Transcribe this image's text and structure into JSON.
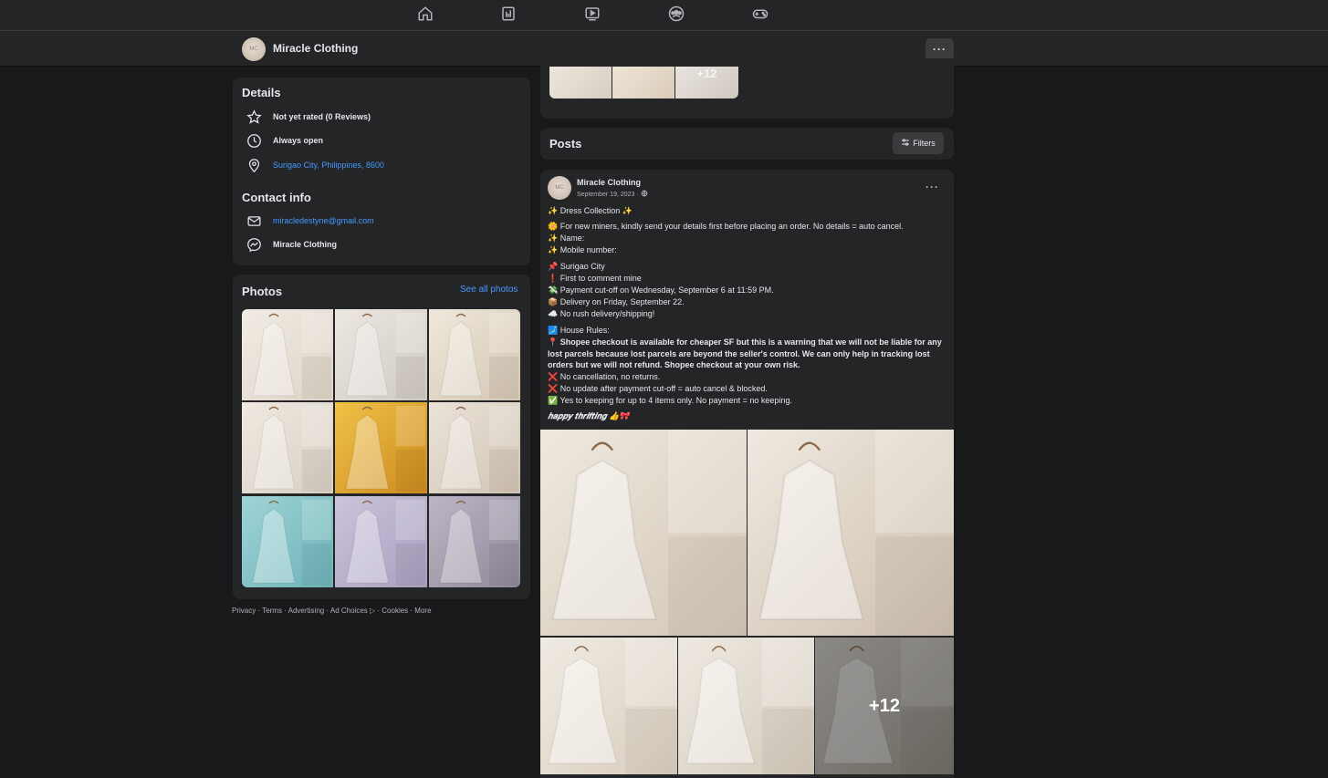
{
  "nav": {
    "icons": [
      "home-icon",
      "pages-icon",
      "video-icon",
      "groups-icon",
      "gaming-icon"
    ]
  },
  "pagebar": {
    "name": "Miracle Clothing",
    "more_label": "···"
  },
  "details": {
    "title": "Details",
    "rating": "Not yet rated (0 Reviews)",
    "hours": "Always open",
    "location": "Surigao City, Philippines, 8600"
  },
  "contact": {
    "title": "Contact info",
    "email": "miracledestyne@gmail.com",
    "messenger": "Miracle Clothing"
  },
  "photos": {
    "title": "Photos",
    "see_all": "See all photos"
  },
  "footer": {
    "text": "Privacy · Terms · Advertising · Ad Choices ▷ · Cookies · More"
  },
  "top_card": {
    "more_count": "+12"
  },
  "posts_header": {
    "title": "Posts",
    "filters_label": "Filters"
  },
  "post": {
    "author": "Miracle Clothing",
    "date": "September 19, 2023 ·",
    "more_label": "···",
    "lines": [
      "✨ Dress Collection ✨",
      "🌼 For new miners, kindly send your details first before placing an order. No details = auto cancel.",
      "✨ Name:",
      "✨ Mobile number:",
      "📌 Surigao City",
      "❗ First to comment mine",
      "💸 Payment cut-off on Wednesday, September 6 at 11:59 PM.",
      "📦 Delivery on Friday, September 22.",
      "☁️ No rush delivery/shipping!",
      "🗾 House Rules:",
      "📍 Shopee checkout is available for cheaper SF but this is a warning that we will not be liable for any",
      "lost parcels because lost parcels are beyond the seller's control. We can only help in tracking lost",
      "orders but we will not refund. Shopee checkout at your own risk.",
      "❌ No cancellation, no returns.",
      "❌ No update after payment cut-off = auto cancel & blocked.",
      "✅ Yes to keeping for up to 4 items only. No payment = no keeping.",
      "𝒉𝒂𝒑𝒑𝒚 𝒕𝒉𝒓𝒊𝒇𝒕𝒊𝒏𝒈 👍🎀"
    ],
    "more_count": "+12"
  },
  "colors": {
    "background": "#18191a",
    "card": "#242526",
    "link": "#4599ff",
    "text": "#e4e6eb"
  }
}
